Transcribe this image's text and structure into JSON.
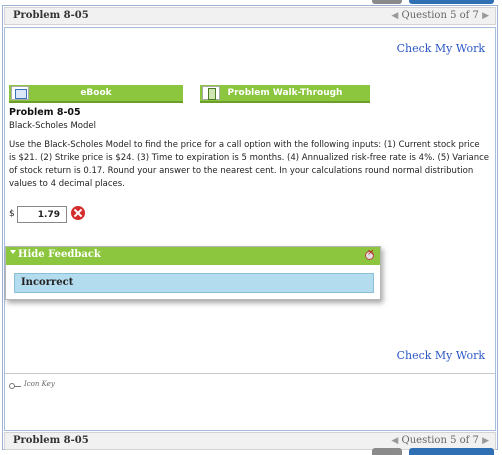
{
  "header": {
    "problem_id": "Problem 8-05",
    "question_nav": "Question 5 of 7",
    "prev_arrow": "◀",
    "next_arrow": "▶"
  },
  "footer": {
    "problem_id": "Problem 8-05",
    "question_nav": "Question 5 of 7",
    "prev_arrow": "◀",
    "next_arrow": "▶"
  },
  "check_my_work_top": "Check My Work",
  "check_my_work_bottom": "Check My Work",
  "tools": {
    "ebook_label": "eBook",
    "walkthrough_label": "Problem Walk-Through"
  },
  "problem": {
    "title": "Problem 8-05",
    "subtitle": "Black-Scholes Model",
    "text": "Use the Black-Scholes Model to find the price for a call option with the following inputs: (1) Current stock price is $21. (2) Strike price is $24. (3) Time to expiration is 5 months. (4) Annualized risk-free rate is 4%. (5) Variance of stock return is 0.17. Round your answer to the nearest cent. In your calculations round normal distribution values to 4 decimal places."
  },
  "answer": {
    "currency": "$",
    "value": "1.79"
  },
  "feedback": {
    "header": "Hide Feedback",
    "message": "Incorrect"
  },
  "icon_key": "Icon Key",
  "colors": {
    "green": "#8cc63e",
    "link_blue": "#2a56c6",
    "feedback_blue": "#b4dcef",
    "error_red": "#d62b2b"
  }
}
